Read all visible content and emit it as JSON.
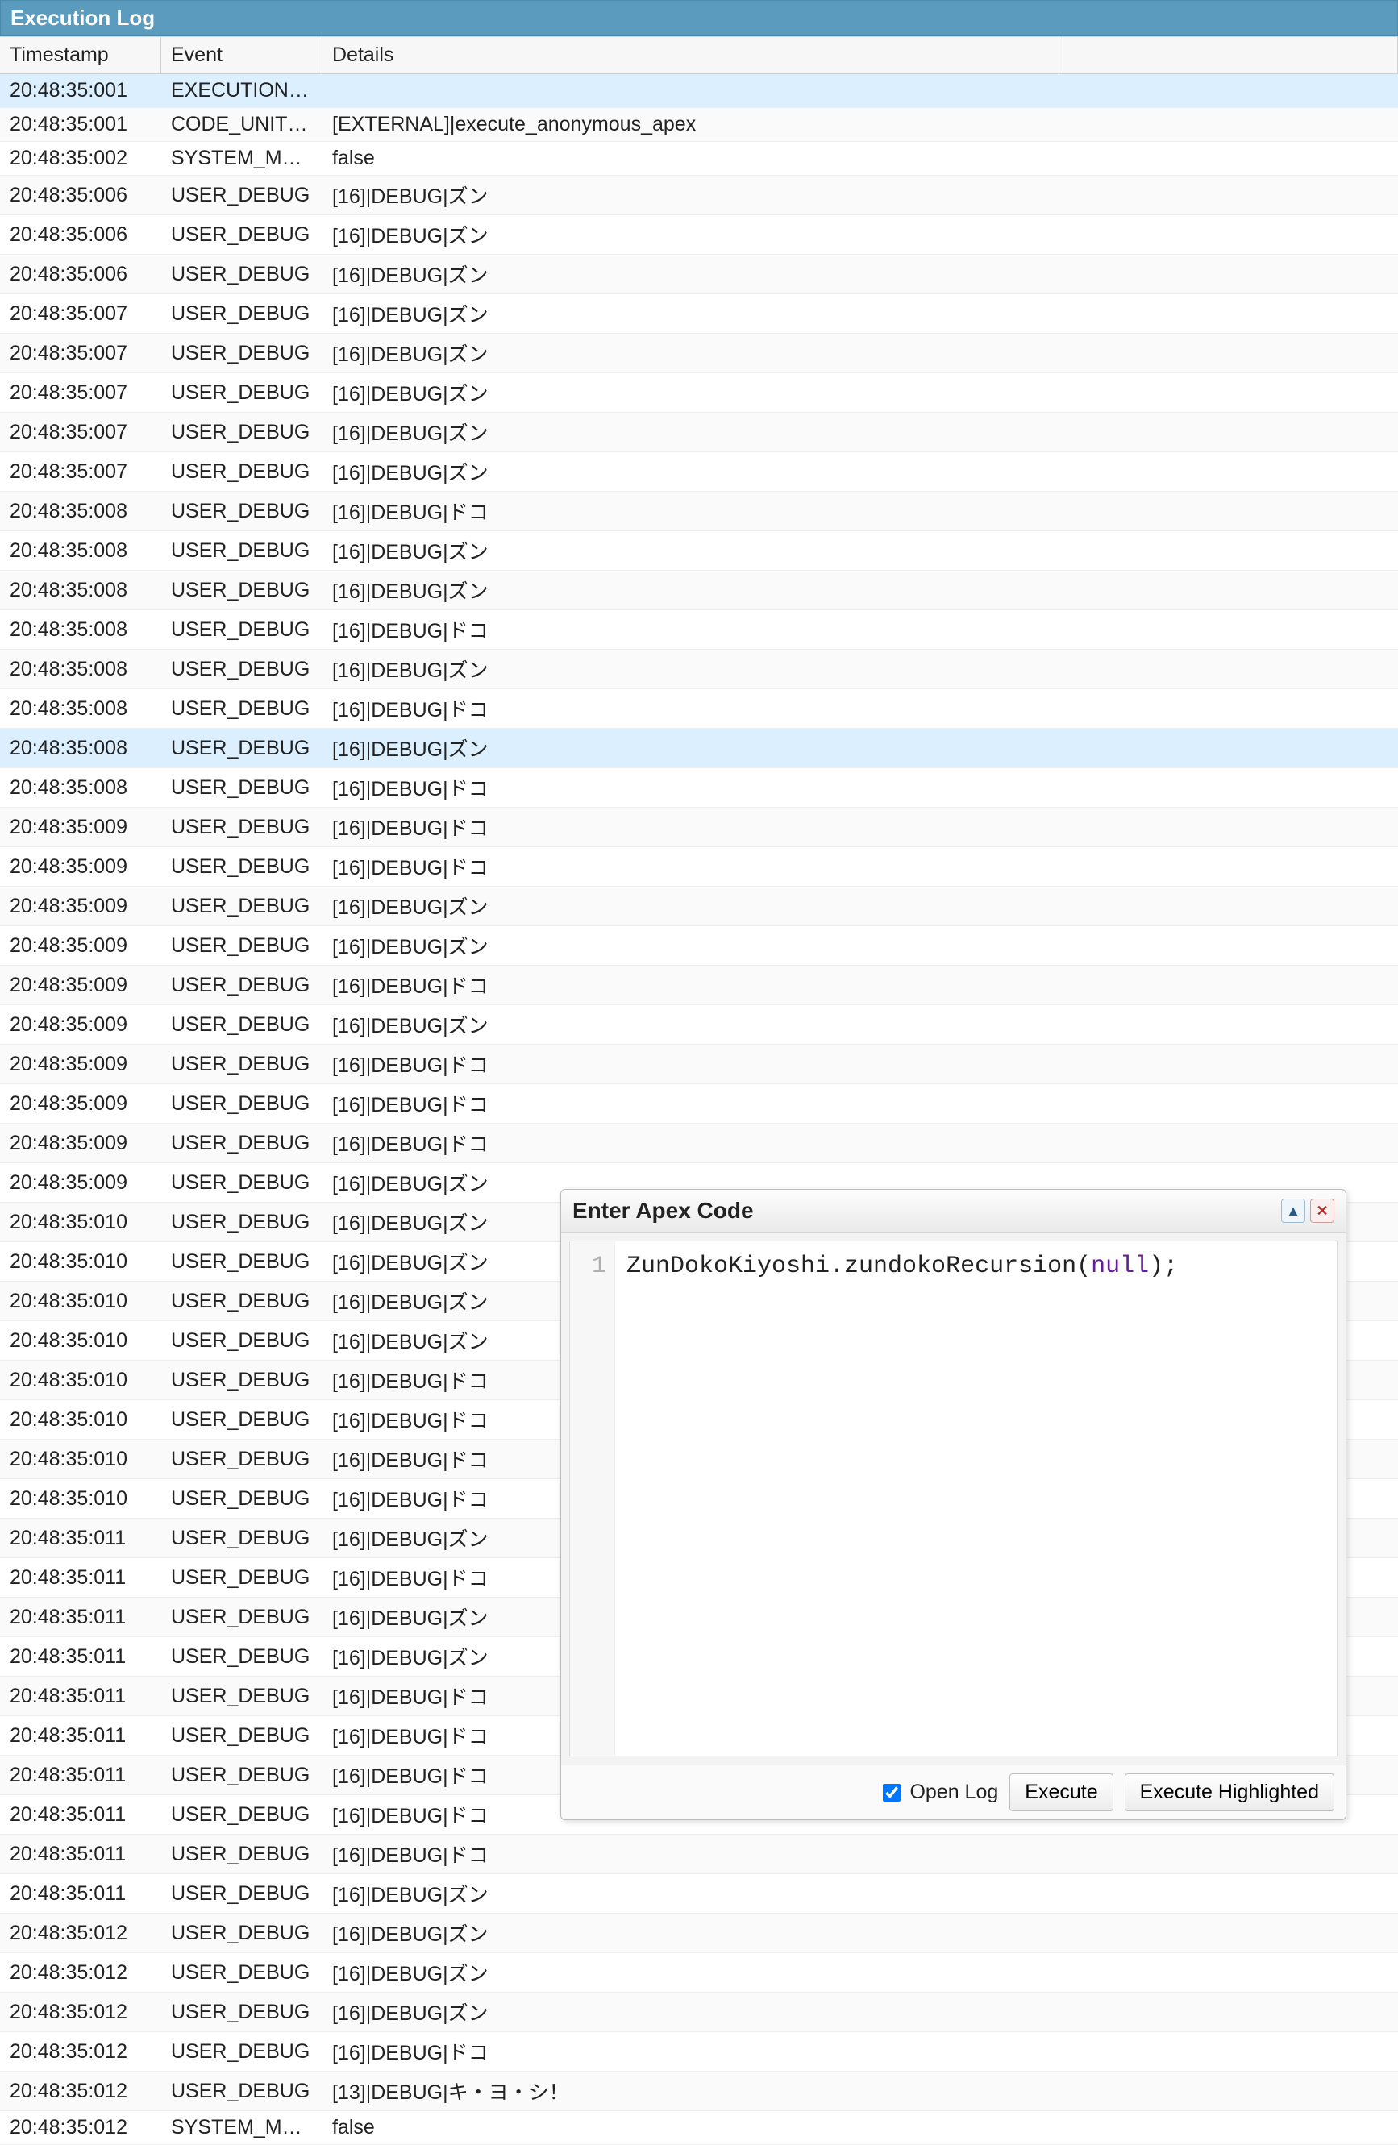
{
  "panel": {
    "title": "Execution Log"
  },
  "columns": {
    "timestamp": "Timestamp",
    "event": "Event",
    "details": "Details"
  },
  "rows": [
    {
      "ts": "20:48:35:001",
      "ev": "EXECUTION_ST...",
      "dt": "",
      "sel": true
    },
    {
      "ts": "20:48:35:001",
      "ev": "CODE_UNIT_ST...",
      "dt": "[EXTERNAL]|execute_anonymous_apex"
    },
    {
      "ts": "20:48:35:002",
      "ev": "SYSTEM_MODE...",
      "dt": "false"
    },
    {
      "ts": "20:48:35:006",
      "ev": "USER_DEBUG",
      "dt": "[16]|DEBUG|ズン"
    },
    {
      "ts": "20:48:35:006",
      "ev": "USER_DEBUG",
      "dt": "[16]|DEBUG|ズン"
    },
    {
      "ts": "20:48:35:006",
      "ev": "USER_DEBUG",
      "dt": "[16]|DEBUG|ズン"
    },
    {
      "ts": "20:48:35:007",
      "ev": "USER_DEBUG",
      "dt": "[16]|DEBUG|ズン"
    },
    {
      "ts": "20:48:35:007",
      "ev": "USER_DEBUG",
      "dt": "[16]|DEBUG|ズン"
    },
    {
      "ts": "20:48:35:007",
      "ev": "USER_DEBUG",
      "dt": "[16]|DEBUG|ズン"
    },
    {
      "ts": "20:48:35:007",
      "ev": "USER_DEBUG",
      "dt": "[16]|DEBUG|ズン"
    },
    {
      "ts": "20:48:35:007",
      "ev": "USER_DEBUG",
      "dt": "[16]|DEBUG|ズン"
    },
    {
      "ts": "20:48:35:008",
      "ev": "USER_DEBUG",
      "dt": "[16]|DEBUG|ドコ"
    },
    {
      "ts": "20:48:35:008",
      "ev": "USER_DEBUG",
      "dt": "[16]|DEBUG|ズン"
    },
    {
      "ts": "20:48:35:008",
      "ev": "USER_DEBUG",
      "dt": "[16]|DEBUG|ズン"
    },
    {
      "ts": "20:48:35:008",
      "ev": "USER_DEBUG",
      "dt": "[16]|DEBUG|ドコ"
    },
    {
      "ts": "20:48:35:008",
      "ev": "USER_DEBUG",
      "dt": "[16]|DEBUG|ズン"
    },
    {
      "ts": "20:48:35:008",
      "ev": "USER_DEBUG",
      "dt": "[16]|DEBUG|ドコ"
    },
    {
      "ts": "20:48:35:008",
      "ev": "USER_DEBUG",
      "dt": "[16]|DEBUG|ズン",
      "sel": true
    },
    {
      "ts": "20:48:35:008",
      "ev": "USER_DEBUG",
      "dt": "[16]|DEBUG|ドコ"
    },
    {
      "ts": "20:48:35:009",
      "ev": "USER_DEBUG",
      "dt": "[16]|DEBUG|ドコ"
    },
    {
      "ts": "20:48:35:009",
      "ev": "USER_DEBUG",
      "dt": "[16]|DEBUG|ドコ"
    },
    {
      "ts": "20:48:35:009",
      "ev": "USER_DEBUG",
      "dt": "[16]|DEBUG|ズン"
    },
    {
      "ts": "20:48:35:009",
      "ev": "USER_DEBUG",
      "dt": "[16]|DEBUG|ズン"
    },
    {
      "ts": "20:48:35:009",
      "ev": "USER_DEBUG",
      "dt": "[16]|DEBUG|ドコ"
    },
    {
      "ts": "20:48:35:009",
      "ev": "USER_DEBUG",
      "dt": "[16]|DEBUG|ズン"
    },
    {
      "ts": "20:48:35:009",
      "ev": "USER_DEBUG",
      "dt": "[16]|DEBUG|ドコ"
    },
    {
      "ts": "20:48:35:009",
      "ev": "USER_DEBUG",
      "dt": "[16]|DEBUG|ドコ"
    },
    {
      "ts": "20:48:35:009",
      "ev": "USER_DEBUG",
      "dt": "[16]|DEBUG|ドコ"
    },
    {
      "ts": "20:48:35:009",
      "ev": "USER_DEBUG",
      "dt": "[16]|DEBUG|ズン"
    },
    {
      "ts": "20:48:35:010",
      "ev": "USER_DEBUG",
      "dt": "[16]|DEBUG|ズン"
    },
    {
      "ts": "20:48:35:010",
      "ev": "USER_DEBUG",
      "dt": "[16]|DEBUG|ズン"
    },
    {
      "ts": "20:48:35:010",
      "ev": "USER_DEBUG",
      "dt": "[16]|DEBUG|ズン"
    },
    {
      "ts": "20:48:35:010",
      "ev": "USER_DEBUG",
      "dt": "[16]|DEBUG|ズン"
    },
    {
      "ts": "20:48:35:010",
      "ev": "USER_DEBUG",
      "dt": "[16]|DEBUG|ドコ"
    },
    {
      "ts": "20:48:35:010",
      "ev": "USER_DEBUG",
      "dt": "[16]|DEBUG|ドコ"
    },
    {
      "ts": "20:48:35:010",
      "ev": "USER_DEBUG",
      "dt": "[16]|DEBUG|ドコ"
    },
    {
      "ts": "20:48:35:010",
      "ev": "USER_DEBUG",
      "dt": "[16]|DEBUG|ドコ"
    },
    {
      "ts": "20:48:35:011",
      "ev": "USER_DEBUG",
      "dt": "[16]|DEBUG|ズン"
    },
    {
      "ts": "20:48:35:011",
      "ev": "USER_DEBUG",
      "dt": "[16]|DEBUG|ドコ"
    },
    {
      "ts": "20:48:35:011",
      "ev": "USER_DEBUG",
      "dt": "[16]|DEBUG|ズン"
    },
    {
      "ts": "20:48:35:011",
      "ev": "USER_DEBUG",
      "dt": "[16]|DEBUG|ズン"
    },
    {
      "ts": "20:48:35:011",
      "ev": "USER_DEBUG",
      "dt": "[16]|DEBUG|ドコ"
    },
    {
      "ts": "20:48:35:011",
      "ev": "USER_DEBUG",
      "dt": "[16]|DEBUG|ドコ"
    },
    {
      "ts": "20:48:35:011",
      "ev": "USER_DEBUG",
      "dt": "[16]|DEBUG|ドコ"
    },
    {
      "ts": "20:48:35:011",
      "ev": "USER_DEBUG",
      "dt": "[16]|DEBUG|ドコ"
    },
    {
      "ts": "20:48:35:011",
      "ev": "USER_DEBUG",
      "dt": "[16]|DEBUG|ドコ"
    },
    {
      "ts": "20:48:35:011",
      "ev": "USER_DEBUG",
      "dt": "[16]|DEBUG|ズン"
    },
    {
      "ts": "20:48:35:012",
      "ev": "USER_DEBUG",
      "dt": "[16]|DEBUG|ズン"
    },
    {
      "ts": "20:48:35:012",
      "ev": "USER_DEBUG",
      "dt": "[16]|DEBUG|ズン"
    },
    {
      "ts": "20:48:35:012",
      "ev": "USER_DEBUG",
      "dt": "[16]|DEBUG|ズン"
    },
    {
      "ts": "20:48:35:012",
      "ev": "USER_DEBUG",
      "dt": "[16]|DEBUG|ドコ"
    },
    {
      "ts": "20:48:35:012",
      "ev": "USER_DEBUG",
      "dt": "[13]|DEBUG|キ・ヨ・シ！"
    },
    {
      "ts": "20:48:35:012",
      "ev": "SYSTEM_MODE...",
      "dt": "false"
    }
  ],
  "dialog": {
    "title": "Enter Apex Code",
    "line_number": "1",
    "code_prefix": "ZunDokoKiyoshi.zundokoRecursion(",
    "code_keyword": "null",
    "code_suffix": ");",
    "open_log_label": "Open Log",
    "open_log_checked": true,
    "execute_label": "Execute",
    "execute_highlighted_label": "Execute Highlighted"
  }
}
